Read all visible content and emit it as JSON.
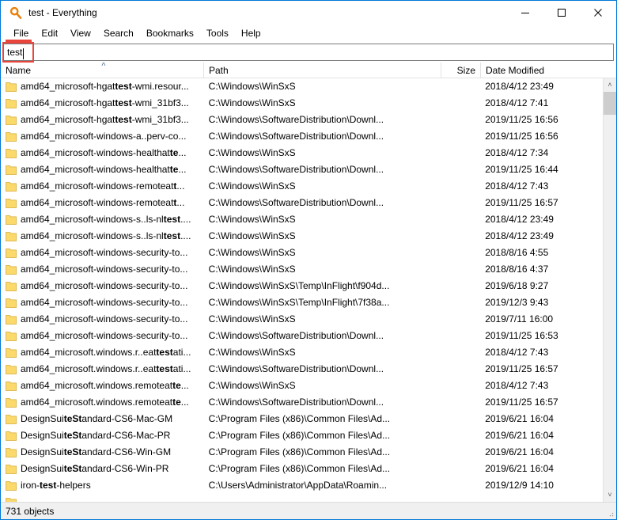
{
  "window": {
    "title": "test - Everything",
    "app_icon": "magnifier-icon",
    "accent_color": "#0078d7",
    "highlight_color": "#e8453c",
    "folder_color": "#fbd96a",
    "controls": {
      "minimize": "minimize-icon",
      "maximize": "maximize-icon",
      "close": "close-icon"
    }
  },
  "menu": {
    "items": [
      {
        "label": "File"
      },
      {
        "label": "Edit"
      },
      {
        "label": "View"
      },
      {
        "label": "Search"
      },
      {
        "label": "Bookmarks"
      },
      {
        "label": "Tools"
      },
      {
        "label": "Help"
      }
    ]
  },
  "search": {
    "value": "test",
    "placeholder": ""
  },
  "columns": [
    {
      "key": "name",
      "label": "Name",
      "sort": "asc",
      "sort_glyph": "˄"
    },
    {
      "key": "path",
      "label": "Path",
      "sort": "none"
    },
    {
      "key": "size",
      "label": "Size",
      "sort": "none"
    },
    {
      "key": "date",
      "label": "Date Modified",
      "sort": "none"
    }
  ],
  "rows": [
    {
      "name_pre": "amd64_microsoft-hgat",
      "name_hit": "test",
      "name_post": "-wmi.resour...",
      "path": "C:\\Windows\\WinSxS",
      "size": "",
      "date": "2018/4/12 23:49"
    },
    {
      "name_pre": "amd64_microsoft-hgat",
      "name_hit": "test",
      "name_post": "-wmi_31bf3...",
      "path": "C:\\Windows\\WinSxS",
      "size": "",
      "date": "2018/4/12 7:41"
    },
    {
      "name_pre": "amd64_microsoft-hgat",
      "name_hit": "test",
      "name_post": "-wmi_31bf3...",
      "path": "C:\\Windows\\SoftwareDistribution\\Downl...",
      "size": "",
      "date": "2019/11/25 16:56"
    },
    {
      "name_pre": "amd64_microsoft-windows-a..perv-co...",
      "name_hit": "",
      "name_post": "",
      "path": "C:\\Windows\\SoftwareDistribution\\Downl...",
      "size": "",
      "date": "2019/11/25 16:56"
    },
    {
      "name_pre": "amd64_microsoft-windows-healthat",
      "name_hit": "te",
      "name_post": "...",
      "path": "C:\\Windows\\WinSxS",
      "size": "",
      "date": "2018/4/12 7:34"
    },
    {
      "name_pre": "amd64_microsoft-windows-healthat",
      "name_hit": "te",
      "name_post": "...",
      "path": "C:\\Windows\\SoftwareDistribution\\Downl...",
      "size": "",
      "date": "2019/11/25 16:44"
    },
    {
      "name_pre": "amd64_microsoft-windows-remoteat",
      "name_hit": "t",
      "name_post": "...",
      "path": "C:\\Windows\\WinSxS",
      "size": "",
      "date": "2018/4/12 7:43"
    },
    {
      "name_pre": "amd64_microsoft-windows-remoteat",
      "name_hit": "t",
      "name_post": "...",
      "path": "C:\\Windows\\SoftwareDistribution\\Downl...",
      "size": "",
      "date": "2019/11/25 16:57"
    },
    {
      "name_pre": "amd64_microsoft-windows-s..ls-nl",
      "name_hit": "test",
      "name_post": "....",
      "path": "C:\\Windows\\WinSxS",
      "size": "",
      "date": "2018/4/12 23:49"
    },
    {
      "name_pre": "amd64_microsoft-windows-s..ls-nl",
      "name_hit": "test",
      "name_post": "....",
      "path": "C:\\Windows\\WinSxS",
      "size": "",
      "date": "2018/4/12 23:49"
    },
    {
      "name_pre": "amd64_microsoft-windows-security-to...",
      "name_hit": "",
      "name_post": "",
      "path": "C:\\Windows\\WinSxS",
      "size": "",
      "date": "2018/8/16 4:55"
    },
    {
      "name_pre": "amd64_microsoft-windows-security-to...",
      "name_hit": "",
      "name_post": "",
      "path": "C:\\Windows\\WinSxS",
      "size": "",
      "date": "2018/8/16 4:37"
    },
    {
      "name_pre": "amd64_microsoft-windows-security-to...",
      "name_hit": "",
      "name_post": "",
      "path": "C:\\Windows\\WinSxS\\Temp\\InFlight\\f904d...",
      "size": "",
      "date": "2019/6/18 9:27"
    },
    {
      "name_pre": "amd64_microsoft-windows-security-to...",
      "name_hit": "",
      "name_post": "",
      "path": "C:\\Windows\\WinSxS\\Temp\\InFlight\\7f38a...",
      "size": "",
      "date": "2019/12/3 9:43"
    },
    {
      "name_pre": "amd64_microsoft-windows-security-to...",
      "name_hit": "",
      "name_post": "",
      "path": "C:\\Windows\\WinSxS",
      "size": "",
      "date": "2019/7/11 16:00"
    },
    {
      "name_pre": "amd64_microsoft-windows-security-to...",
      "name_hit": "",
      "name_post": "",
      "path": "C:\\Windows\\SoftwareDistribution\\Downl...",
      "size": "",
      "date": "2019/11/25 16:53"
    },
    {
      "name_pre": "amd64_microsoft.windows.r..eat",
      "name_hit": "test",
      "name_post": "ati...",
      "path": "C:\\Windows\\WinSxS",
      "size": "",
      "date": "2018/4/12 7:43"
    },
    {
      "name_pre": "amd64_microsoft.windows.r..eat",
      "name_hit": "test",
      "name_post": "ati...",
      "path": "C:\\Windows\\SoftwareDistribution\\Downl...",
      "size": "",
      "date": "2019/11/25 16:57"
    },
    {
      "name_pre": "amd64_microsoft.windows.remoteat",
      "name_hit": "te",
      "name_post": "...",
      "path": "C:\\Windows\\WinSxS",
      "size": "",
      "date": "2018/4/12 7:43"
    },
    {
      "name_pre": "amd64_microsoft.windows.remoteat",
      "name_hit": "te",
      "name_post": "...",
      "path": "C:\\Windows\\SoftwareDistribution\\Downl...",
      "size": "",
      "date": "2019/11/25 16:57"
    },
    {
      "name_pre": "DesignSui",
      "name_hit": "teSt",
      "name_post": "andard-CS6-Mac-GM",
      "path": "C:\\Program Files (x86)\\Common Files\\Ad...",
      "size": "",
      "date": "2019/6/21 16:04"
    },
    {
      "name_pre": "DesignSui",
      "name_hit": "teSt",
      "name_post": "andard-CS6-Mac-PR",
      "path": "C:\\Program Files (x86)\\Common Files\\Ad...",
      "size": "",
      "date": "2019/6/21 16:04"
    },
    {
      "name_pre": "DesignSui",
      "name_hit": "teSt",
      "name_post": "andard-CS6-Win-GM",
      "path": "C:\\Program Files (x86)\\Common Files\\Ad...",
      "size": "",
      "date": "2019/6/21 16:04"
    },
    {
      "name_pre": "DesignSui",
      "name_hit": "teSt",
      "name_post": "andard-CS6-Win-PR",
      "path": "C:\\Program Files (x86)\\Common Files\\Ad...",
      "size": "",
      "date": "2019/6/21 16:04"
    },
    {
      "name_pre": "iron-",
      "name_hit": "test",
      "name_post": "-helpers",
      "path": "C:\\Users\\Administrator\\AppData\\Roamin...",
      "size": "",
      "date": "2019/12/9 14:10"
    }
  ],
  "scrollbar": {
    "up_glyph": "˄",
    "down_glyph": "˅"
  },
  "status": {
    "text": "731 objects"
  }
}
